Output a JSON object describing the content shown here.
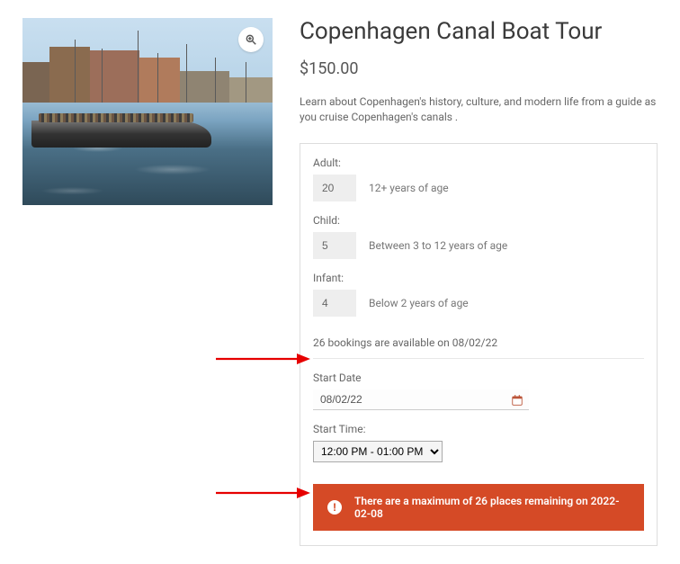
{
  "product": {
    "title": "Copenhagen Canal Boat Tour",
    "price": "$150.00",
    "description": "Learn about Copenhagen's history, culture, and modern life from a guide as you cruise Copenhagen's canals ."
  },
  "form": {
    "adult": {
      "label": "Adult:",
      "value": "20",
      "hint": "12+ years of age"
    },
    "child": {
      "label": "Child:",
      "value": "5",
      "hint": "Between 3 to 12 years of age"
    },
    "infant": {
      "label": "Infant:",
      "value": "4",
      "hint": "Below 2 years of age"
    },
    "availability_text": "26 bookings are available on 08/02/22",
    "start_date": {
      "label": "Start Date",
      "value": "08/02/22"
    },
    "start_time": {
      "label": "Start Time:",
      "selected": "12:00 PM - 01:00 PM"
    },
    "alert_text": "There are a maximum of 26 places remaining on 2022-02-08"
  }
}
